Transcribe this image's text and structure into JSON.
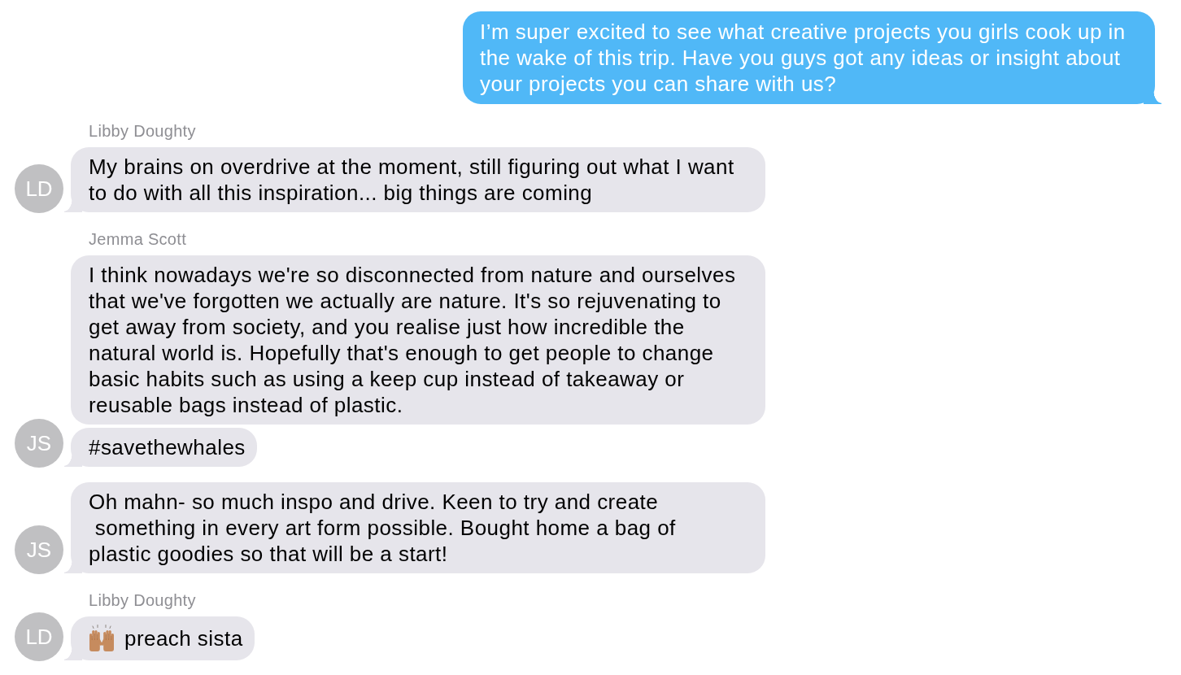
{
  "messages": [
    {
      "kind": "outgoing",
      "text": "I’m super excited to see what creative projects you girls cook up in\nthe wake of this trip. Have you guys got any ideas or insight about\nyour projects you can share with us?"
    },
    {
      "kind": "incoming",
      "sender": "Libby Doughty",
      "text": "My brains on overdrive at the moment, still figuring out what I want\nto do with all this inspiration... big things are coming",
      "avatar": "LD"
    },
    {
      "kind": "incoming",
      "sender": "Jemma Scott",
      "text": "I think nowadays we're so disconnected from nature and ourselves\nthat we've forgotten we actually are nature. It's so rejuvenating to\nget away from society, and you realise just how incredible the\nnatural world is. Hopefully that's enough to get people to change\nbasic habits such as using a keep cup instead of takeaway or\nreusable bags instead of plastic."
    },
    {
      "kind": "incoming",
      "text": "#savethewhales",
      "avatar": "JS"
    },
    {
      "kind": "incoming",
      "text": "Oh mahn- so much inspo and drive. Keen to try and create\n something in every art form possible. Bought home a bag of\nplastic goodies so that will be a start!",
      "avatar": "JS"
    },
    {
      "kind": "incoming",
      "sender": "Libby Doughty",
      "text": "preach sista",
      "avatar": "LD",
      "emoji": true
    }
  ]
}
